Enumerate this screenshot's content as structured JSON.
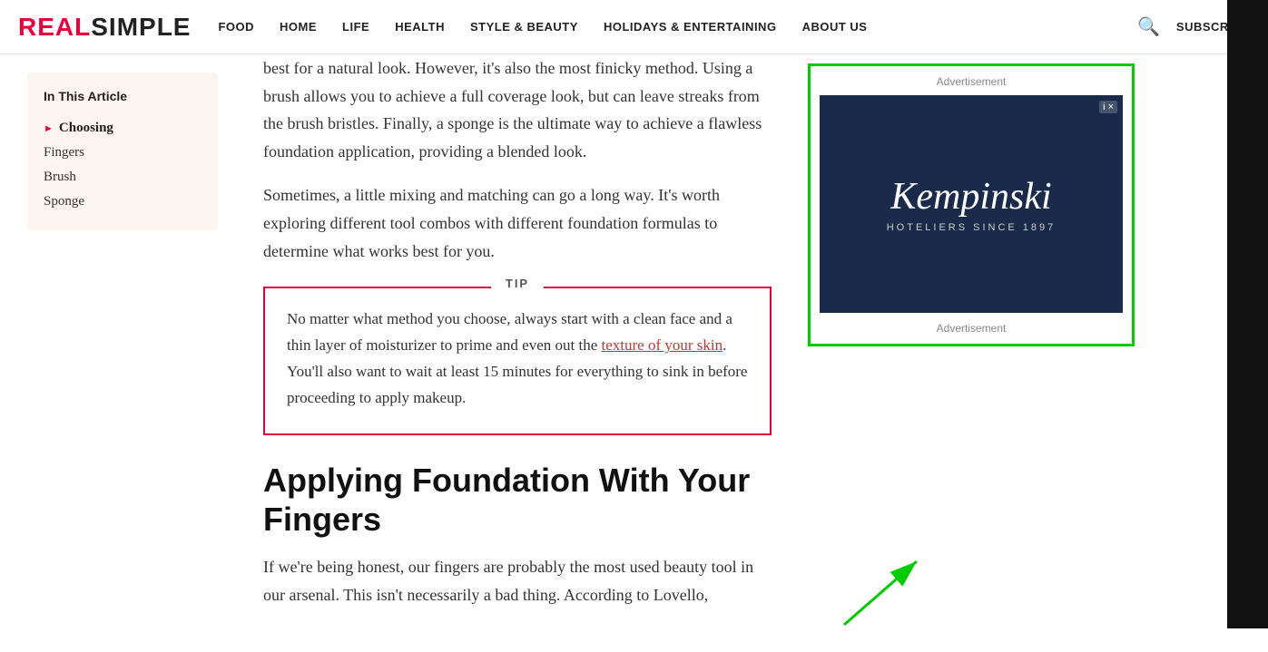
{
  "header": {
    "logo_real": "REAL",
    "logo_simple": "SIMPLE",
    "nav_items": [
      {
        "label": "FOOD",
        "id": "food"
      },
      {
        "label": "HOME",
        "id": "home"
      },
      {
        "label": "LIFE",
        "id": "life"
      },
      {
        "label": "HEALTH",
        "id": "health"
      },
      {
        "label": "STYLE & BEAUTY",
        "id": "style-beauty"
      },
      {
        "label": "HOLIDAYS & ENTERTAINING",
        "id": "holidays"
      },
      {
        "label": "ABOUT US",
        "id": "about-us"
      }
    ],
    "subscribe_label": "SUBSCRIBE"
  },
  "sidebar": {
    "toc_title": "In This Article",
    "toc_items": [
      {
        "label": "Choosing",
        "active": true
      },
      {
        "label": "Fingers",
        "active": false
      },
      {
        "label": "Brush",
        "active": false
      },
      {
        "label": "Sponge",
        "active": false
      }
    ]
  },
  "main": {
    "paragraph1": "best for a natural look. However, it's also the most finicky method. Using a brush allows you to achieve a full coverage look, but can leave streaks from the brush bristles. Finally, a sponge is the ultimate way to achieve a flawless foundation application, providing a blended look.",
    "paragraph2": "Sometimes, a little mixing and matching can go a long way. It's worth exploring different tool combos with different foundation formulas to determine what works best for you.",
    "tip_label": "TIP",
    "tip_text_before_link": "No matter what method you choose, always start with a clean face and a thin layer of moisturizer to prime and even out the ",
    "tip_link_text": "texture of your skin",
    "tip_text_after_link": ". You'll also want to wait at least 15 minutes for everything to sink in before proceeding to apply makeup.",
    "section_heading_line1": "Applying Foundation With Your",
    "section_heading_line2": "Fingers",
    "paragraph3_start": "If we're being honest, our fingers are probably the most used beauty tool in our arsenal. This isn't necessarily a bad thing. According to Lovello,"
  },
  "ad": {
    "label_top": "Advertisement",
    "brand_name": "Kempinski",
    "brand_tagline": "HOTELIERS SINCE 1897",
    "label_bottom": "Advertisement",
    "info_badge": "i ×"
  },
  "colors": {
    "accent": "#e8003d",
    "link": "#c0392b",
    "nav_text": "#222",
    "ad_border": "#00cc00",
    "ad_bg": "#1a2a4a"
  }
}
